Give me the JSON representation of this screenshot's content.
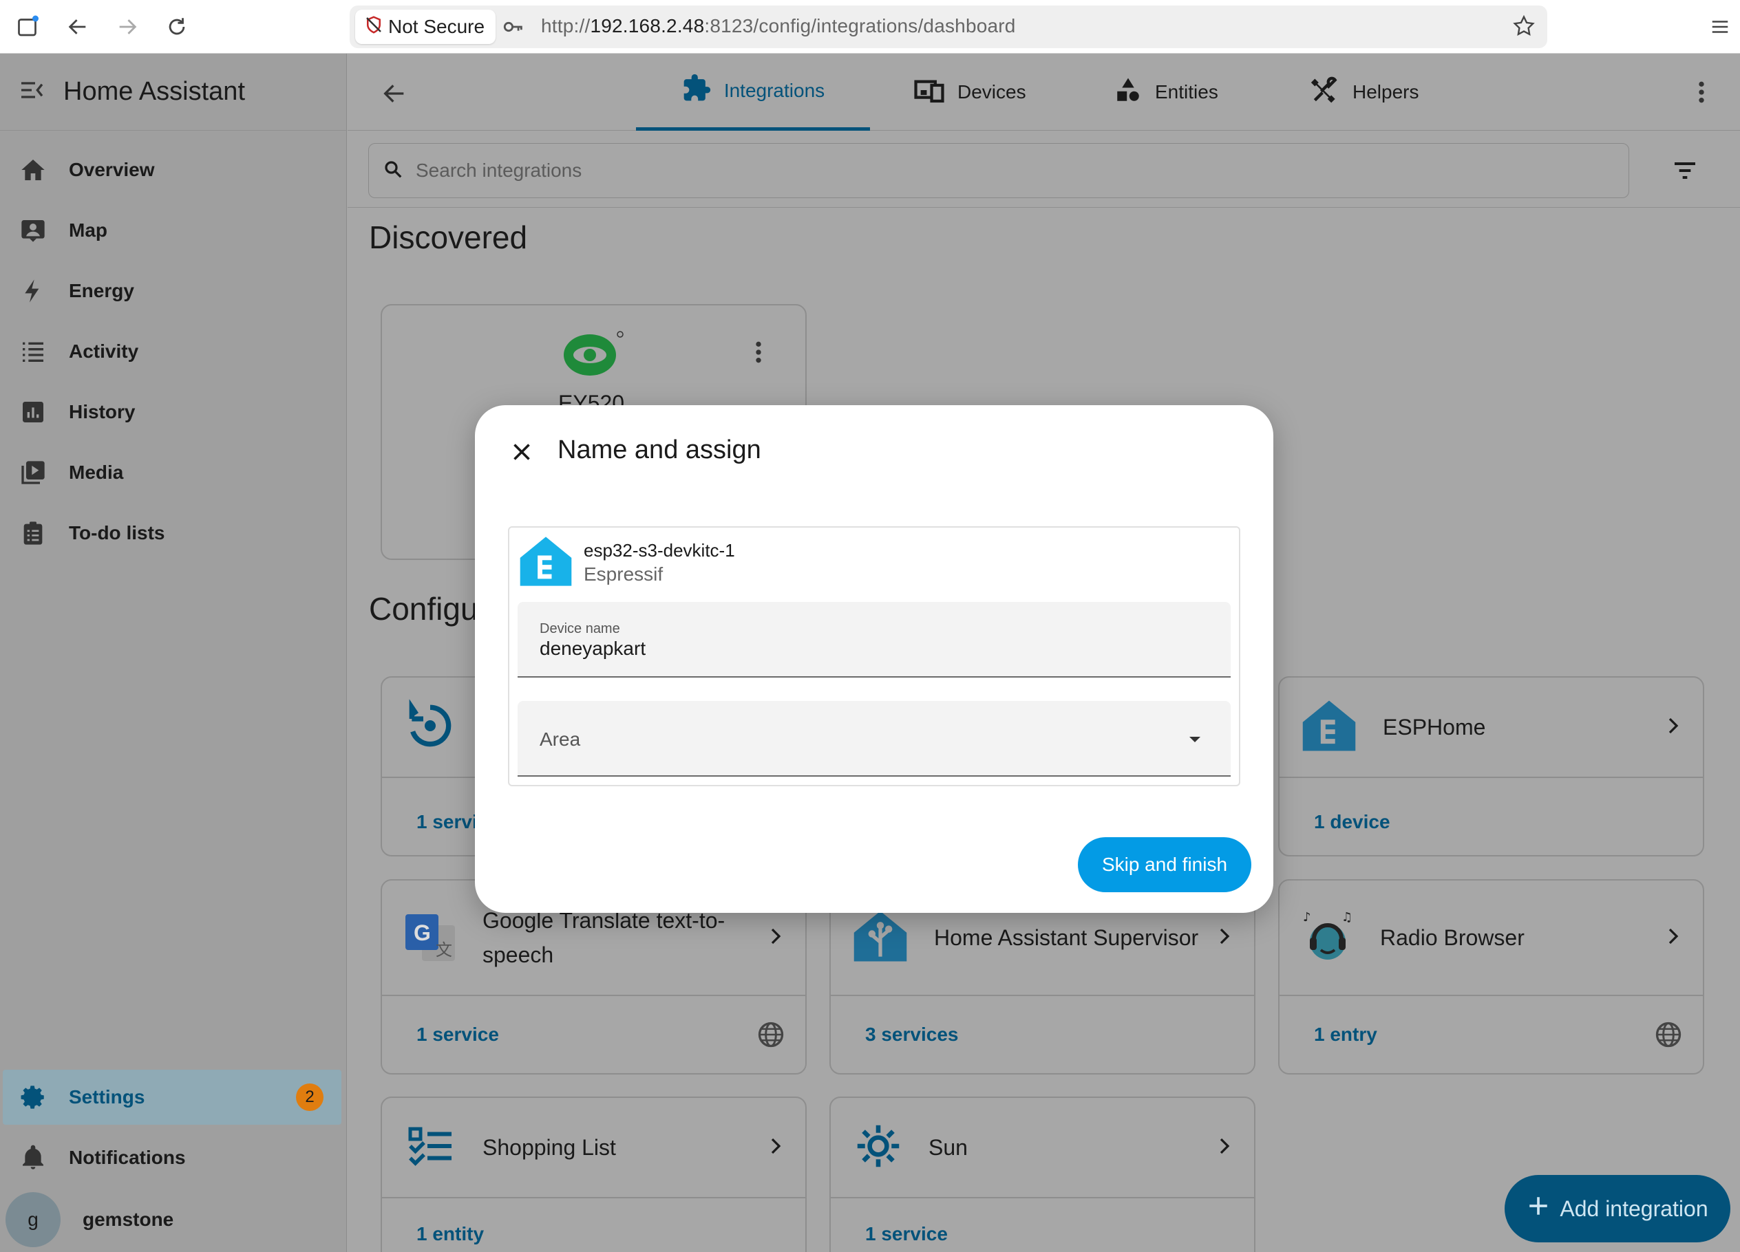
{
  "browser": {
    "not_secure": "Not Secure",
    "url_prefix": "http://",
    "url_host": "192.168.2.48",
    "url_rest": ":8123/config/integrations/dashboard",
    "icons": [
      "tab-icon",
      "back-icon",
      "forward-icon",
      "reload-icon",
      "shield-off-icon",
      "key-icon",
      "star-icon",
      "menu-icon"
    ]
  },
  "sidebar": {
    "title": "Home Assistant",
    "items": [
      {
        "label": "Overview",
        "icon": "home-icon"
      },
      {
        "label": "Map",
        "icon": "map-icon"
      },
      {
        "label": "Energy",
        "icon": "lightning-icon"
      },
      {
        "label": "Activity",
        "icon": "list-icon"
      },
      {
        "label": "History",
        "icon": "chart-icon"
      },
      {
        "label": "Media",
        "icon": "media-icon"
      },
      {
        "label": "To-do lists",
        "icon": "clipboard-icon"
      }
    ],
    "settings": {
      "label": "Settings",
      "badge": "2"
    },
    "notifications": {
      "label": "Notifications"
    },
    "user": {
      "initial": "g",
      "name": "gemstone"
    }
  },
  "tabs": [
    {
      "label": "Integrations",
      "icon": "puzzle-icon"
    },
    {
      "label": "Devices",
      "icon": "devices-icon"
    },
    {
      "label": "Entities",
      "icon": "shapes-icon"
    },
    {
      "label": "Helpers",
      "icon": "tools-icon"
    }
  ],
  "search": {
    "placeholder": "Search integrations"
  },
  "discovered": {
    "title": "Discovered",
    "partial_name": "EY520"
  },
  "configured": {
    "title": "Configu"
  },
  "cards": {
    "backup": {
      "footer": "1 servi"
    },
    "esphome": {
      "name": "ESPHome",
      "footer": "1 device"
    },
    "google": {
      "name": "Google Translate text-to-speech",
      "footer": "1 service"
    },
    "supervisor": {
      "name": "Home Assistant Supervisor",
      "footer": "3 services"
    },
    "radio": {
      "name": "Radio Browser",
      "footer": "1 entry"
    },
    "shopping": {
      "name": "Shopping List",
      "footer": "1 entity"
    },
    "sun": {
      "name": "Sun",
      "footer": "1 service"
    }
  },
  "fab": {
    "label": "Add integration"
  },
  "dialog": {
    "title": "Name and assign",
    "device": {
      "name": "esp32-s3-devkitc-1",
      "manufacturer": "Espressif"
    },
    "device_name_label": "Device name",
    "device_name_value": "deneyapkart",
    "area_label": "Area",
    "skip_button": "Skip and finish"
  },
  "colors": {
    "accent": "#03527a",
    "primary_button": "#039be5",
    "badge": "#e07d0f",
    "esphome": "#18b2e9"
  }
}
